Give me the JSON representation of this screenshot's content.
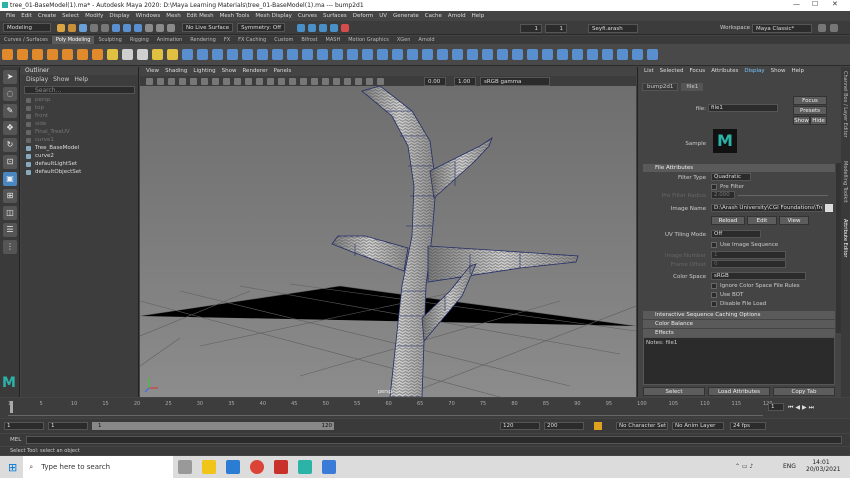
{
  "window": {
    "title": "tree_01-BaseModel(1).ma* - Autodesk Maya 2020: D:\\Maya Learning Materials\\tree_01-BaseModel(1).ma  ---  bump2d1",
    "minimize": "—",
    "maximize": "☐",
    "close": "✕"
  },
  "menu": [
    "File",
    "Edit",
    "Create",
    "Select",
    "Modify",
    "Display",
    "Windows",
    "Mesh",
    "Edit Mesh",
    "Mesh Tools",
    "Mesh Display",
    "Curves",
    "Surfaces",
    "Deform",
    "UV",
    "Generate",
    "Cache",
    "Arnold",
    "Help"
  ],
  "workspace": {
    "label": "Workspace :",
    "value": "Maya Classic*"
  },
  "status": {
    "mode": "Modeling",
    "live": "No Live Surface",
    "symmetry": "Symmetry: Off",
    "user": "Seyfi.arash",
    "num1": "1",
    "num2": "1"
  },
  "shelf_tabs": [
    "Curves / Surfaces",
    "Poly Modeling",
    "Sculpting",
    "Rigging",
    "Animation",
    "Rendering",
    "FX",
    "FX Caching",
    "Custom",
    "Bifrost",
    "MASH",
    "Motion Graphics",
    "XGen",
    "Arnold"
  ],
  "shelf_active": "Poly Modeling",
  "outliner": {
    "title": "Outliner",
    "menu": [
      "Display",
      "Show",
      "Help"
    ],
    "search_placeholder": "Search...",
    "items": [
      {
        "label": "persp",
        "dim": true
      },
      {
        "label": "top",
        "dim": true
      },
      {
        "label": "front",
        "dim": true
      },
      {
        "label": "side",
        "dim": true
      },
      {
        "label": "Final_TreeUV",
        "dim": true
      },
      {
        "label": "curve1",
        "dim": true
      },
      {
        "label": "Tree_BaseModel",
        "dim": false
      },
      {
        "label": "curve2",
        "dim": false
      },
      {
        "label": "defaultLightSet",
        "dim": false
      },
      {
        "label": "defaultObjectSet",
        "dim": false
      }
    ]
  },
  "viewport": {
    "menu": [
      "View",
      "Shading",
      "Lighting",
      "Show",
      "Renderer",
      "Panels"
    ],
    "exposure": "0.00",
    "gamma": "1.00",
    "colorspace": "sRGB gamma",
    "camera": "persp"
  },
  "attr": {
    "menu": [
      "List",
      "Selected",
      "Focus",
      "Attributes",
      "Display",
      "Show",
      "Help"
    ],
    "tabs": [
      "bump2d1",
      "file1"
    ],
    "file_label": "file:",
    "file_value": "file1",
    "focus": "Focus",
    "presets": "Presets",
    "show": "Show",
    "hide": "Hide",
    "sample": "Sample",
    "section_file": "File Attributes",
    "filter_type_label": "Filter Type",
    "filter_type": "Quadratic",
    "pre_filter": "Pre Filter",
    "pre_filter_radius_label": "Pre Filter Radius",
    "pre_filter_radius": "2.000",
    "image_name_label": "Image Name",
    "image_name": "D:\\Arash University\\CGI Foundations\\Tree.tif",
    "reload": "Reload",
    "edit": "Edit",
    "view": "View",
    "uv_tiling_label": "UV Tiling Mode",
    "uv_tiling": "Off",
    "use_image_seq": "Use Image Sequence",
    "image_number_label": "Image Number",
    "image_number": "1",
    "frame_offset_label": "Frame Offset",
    "frame_offset": "0",
    "color_space_label": "Color Space",
    "color_space": "sRGB",
    "ignore_cs": "Ignore Color Space File Rules",
    "use_bot": "Use BOT",
    "disable_load": "Disable File Load",
    "sections": [
      "Interactive Sequence Caching Options",
      "Color Balance",
      "Effects"
    ],
    "notes": "Notes: file1",
    "select": "Select",
    "load": "Load Attributes",
    "copy": "Copy Tab"
  },
  "side_tabs": [
    "Channel Box / Layer Editor",
    "Modelling Toolkit",
    "Attribute Editor"
  ],
  "timeline": {
    "ticks": [
      "1",
      "5",
      "10",
      "15",
      "20",
      "25",
      "30",
      "35",
      "40",
      "45",
      "50",
      "55",
      "60",
      "65",
      "70",
      "75",
      "80",
      "85",
      "90",
      "95",
      "100",
      "105",
      "110",
      "115",
      "120"
    ],
    "current": "1"
  },
  "range": {
    "start": "1",
    "inner_start": "1",
    "inner_end": "120",
    "end": "120",
    "anim_end": "200",
    "character": "No Character Set",
    "anim_layer": "No Anim Layer",
    "fps": "24 fps"
  },
  "mel": "MEL",
  "help": "Select Tool: select an object",
  "taskbar": {
    "search": "Type here to search",
    "time": "14:01",
    "date": "20/03/2021",
    "lang": "ENG"
  },
  "colors": {
    "accent": "#4aa3df",
    "maya_teal": "#2bb3a8"
  }
}
